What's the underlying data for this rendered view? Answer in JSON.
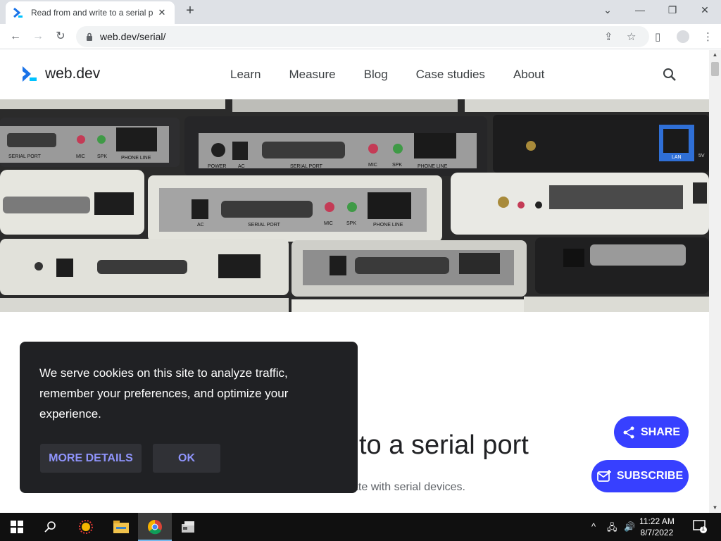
{
  "browser": {
    "tab_title": "Read from and write to a serial p",
    "tab_close": "✕",
    "new_tab": "+",
    "url": "web.dev/serial/",
    "window_controls": {
      "minimize": "—",
      "maximize": "❐",
      "close": "✕",
      "tab_list": "⌄"
    }
  },
  "site": {
    "name": "web.dev",
    "nav": [
      "Learn",
      "Measure",
      "Blog",
      "Case studies",
      "About"
    ]
  },
  "hero": {
    "labels_row1": [
      "SERIAL PORT",
      "MIC",
      "SPK",
      "PHONE LINE"
    ],
    "labels_row1b": [
      "POWER",
      "AC",
      "SERIAL PORT",
      "MIC",
      "SPK",
      "PHONE LINE"
    ],
    "labels_row2": [
      "AC",
      "SERIAL PORT",
      "MIC",
      "SPK",
      "PHONE LINE"
    ],
    "lan": "LAN",
    "fivev": "5V"
  },
  "article": {
    "title_visible": "to a serial port",
    "subtitle_visible": "ate with serial devices."
  },
  "actions": {
    "share": "SHARE",
    "subscribe": "SUBSCRIBE"
  },
  "cookie": {
    "text": "We serve cookies on this site to analyze traffic, remember your preferences, and optimize your experience.",
    "more_details": "MORE DETAILS",
    "ok": "OK"
  },
  "taskbar": {
    "time": "11:22 AM",
    "date": "8/7/2022",
    "notification_count": "1"
  },
  "colors": {
    "accent": "#3740ff",
    "cookie_bg": "#202124",
    "taskbar_bg": "#101010"
  }
}
